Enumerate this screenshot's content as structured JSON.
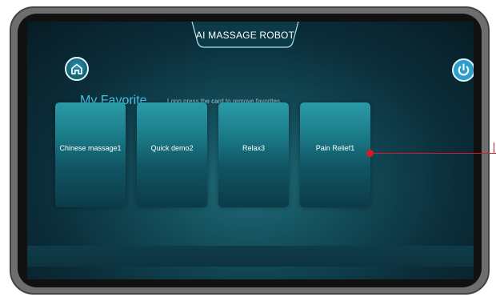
{
  "app": {
    "title": "AI MASSAGE ROBOT"
  },
  "header": {
    "home_icon": "home-icon",
    "power_icon": "power-icon"
  },
  "favorites": {
    "heading": "My Favorite",
    "hint": "Long press the card to remove favorites",
    "cards": [
      {
        "label": "Chinese massage1"
      },
      {
        "label": "Quick demo2"
      },
      {
        "label": "Relax3"
      },
      {
        "label": "Pain Relief1"
      }
    ]
  },
  "colors": {
    "accent": "#41c4e8",
    "power_button": "#2d9fc8",
    "card_top": "#2a9ba7",
    "card_bottom": "#0c3b48",
    "pointer": "#d8192a"
  }
}
